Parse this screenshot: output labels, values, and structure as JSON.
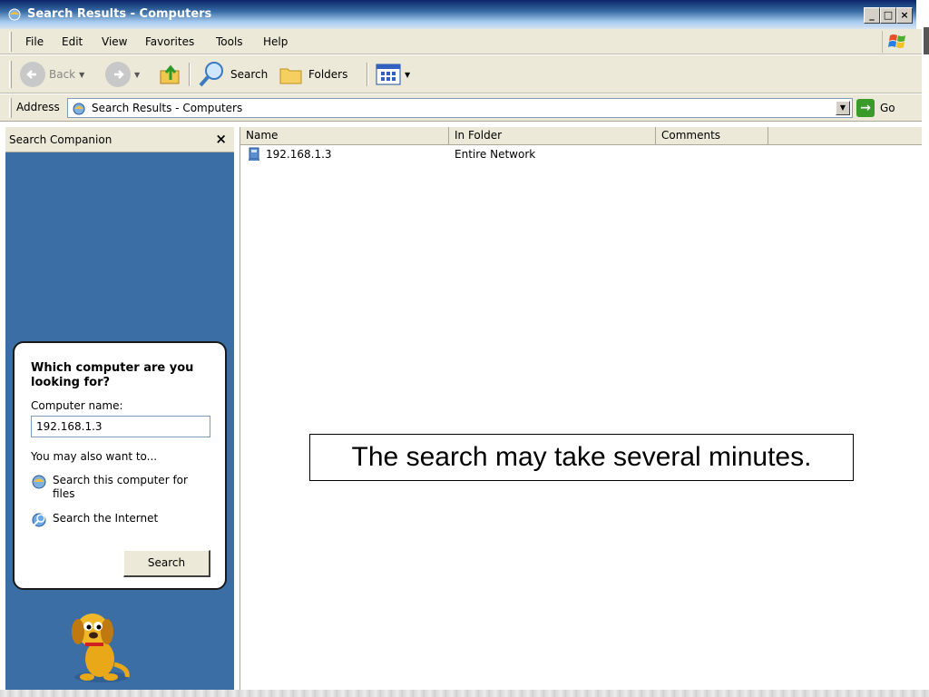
{
  "window": {
    "title": "Search Results - Computers"
  },
  "menu": {
    "items": [
      "File",
      "Edit",
      "View",
      "Favorites",
      "Tools",
      "Help"
    ]
  },
  "toolbar": {
    "back_label": "Back",
    "search_label": "Search",
    "folders_label": "Folders"
  },
  "address": {
    "label": "Address",
    "value": "Search Results - Computers",
    "go_label": "Go"
  },
  "sidebar": {
    "title": "Search Companion",
    "close_glyph": "×",
    "question": "Which computer are you looking for?",
    "computer_name_label": "Computer name:",
    "computer_name_value": "192.168.1.3",
    "also_label": "You may also want to...",
    "links": [
      "Search this computer for files",
      "Search the Internet"
    ],
    "search_button": "Search"
  },
  "list": {
    "columns": [
      "Name",
      "In Folder",
      "Comments"
    ],
    "rows": [
      {
        "name": "192.168.1.3",
        "folder": "Entire Network",
        "comments": ""
      }
    ]
  },
  "callout": {
    "text": "The search may take several minutes."
  },
  "colors": {
    "sidebar_bg": "#3a6ea5",
    "title_bar": "#0a246a",
    "chrome": "#ece9d8"
  }
}
